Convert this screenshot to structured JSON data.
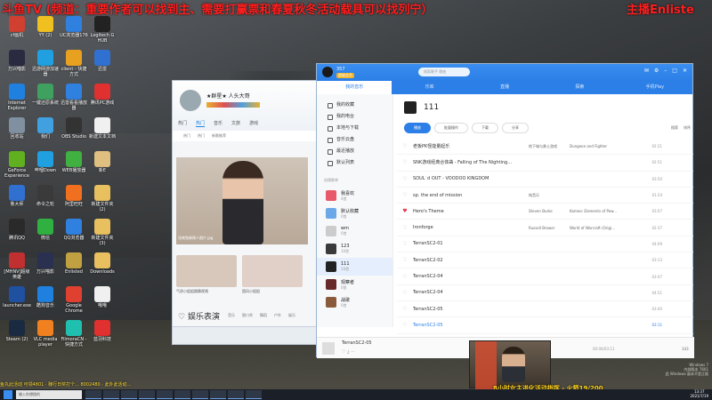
{
  "banner": {
    "left": "斗鱼TV (频道：重要作者可以找到主、需要打赢票和春夏秋冬活动载具可以找列宁）",
    "right": "主播Enliste"
  },
  "desktop_icons": [
    {
      "label": "cf画机",
      "color": "#d04030"
    },
    {
      "label": "YY (2)",
      "color": "#f0c020"
    },
    {
      "label": "UC浏览器176",
      "color": "#3080e0"
    },
    {
      "label": "Logitech G HUB",
      "color": "#222222"
    },
    {
      "label": "万兴喵影",
      "color": "#2a2a40"
    },
    {
      "label": "迅游网游加速器",
      "color": "#20a0e0"
    },
    {
      "label": "client - 快捷方式",
      "color": "#e8a020"
    },
    {
      "label": "迅雷",
      "color": "#3070d0"
    },
    {
      "label": "Internet Explorer",
      "color": "#2080e0"
    },
    {
      "label": "一键还原系统",
      "color": "#40a060"
    },
    {
      "label": "迅雷看看播放器",
      "color": "#3080e0"
    },
    {
      "label": "腾讯PC游戏",
      "color": "#e03030"
    },
    {
      "label": "回收站",
      "color": "#8090a0"
    },
    {
      "label": "我们",
      "color": "#40a0e0"
    },
    {
      "label": "OBS Studio",
      "color": "#333333"
    },
    {
      "label": "新建文本文档",
      "color": "#f0f0f0"
    },
    {
      "label": "GeForce Experience",
      "color": "#60b020"
    },
    {
      "label": "哔哩Down",
      "color": "#20a0e0"
    },
    {
      "label": "WEB播放器",
      "color": "#40b040"
    },
    {
      "label": "新E",
      "color": "#e0c080"
    },
    {
      "label": "鲁大师",
      "color": "#3070d0"
    },
    {
      "label": "命令之轮",
      "color": "#3a3a3a"
    },
    {
      "label": "阿里旺旺",
      "color": "#f07020"
    },
    {
      "label": "新建文件夹 (2)",
      "color": "#e8c060"
    },
    {
      "label": "腾讯QQ",
      "color": "#2a2a2a"
    },
    {
      "label": "微信",
      "color": "#30b040"
    },
    {
      "label": "QQ浏览器",
      "color": "#3080e0"
    },
    {
      "label": "新建文件夹 (3)",
      "color": "#e8c060"
    },
    {
      "label": "[MHNV]超级英雄",
      "color": "#c03030"
    },
    {
      "label": "万兴喵影",
      "color": "#2a3050"
    },
    {
      "label": "Enlisted",
      "color": "#c0a040"
    },
    {
      "label": "Downloads",
      "color": "#e8c060"
    },
    {
      "label": "launcher.exe",
      "color": "#2050a0"
    },
    {
      "label": "酷狗音乐",
      "color": "#2080e0"
    },
    {
      "label": "Google Chrome",
      "color": "#e04030"
    },
    {
      "label": "哦哦",
      "color": "#f0f0f0"
    },
    {
      "label": "Steam (2)",
      "color": "#1a2a40"
    },
    {
      "label": "VLC media player",
      "color": "#f08020"
    },
    {
      "label": "FilmoraCN - 快捷方式",
      "color": "#20c0b0"
    },
    {
      "label": "蓝羽科技",
      "color": "#e03030"
    }
  ],
  "qq_window": {
    "nickname": "★群星★  人头大哥",
    "tabs": [
      "热门",
      "热门",
      "音乐",
      "文旅",
      "游戏"
    ],
    "subtabs": [
      "热门",
      "热门",
      "新歌推荐"
    ],
    "banner_caption": "深夜独奏撩人图片.jpg",
    "thumb_caption_1": "气质小姐姐跳舞视频",
    "thumb_caption_2": "国风小姐姐",
    "section_title": "娱乐表演",
    "section_tabs": [
      "音乐",
      "脱口秀",
      "舞蹈",
      "户外",
      "娱乐"
    ]
  },
  "music": {
    "user": "357",
    "vip": "超级会员",
    "search_placeholder": "搜索歌手 歌曲",
    "nav": [
      "我的音乐",
      "乐库",
      "直播",
      "探索",
      "手机Play"
    ],
    "sidebar": {
      "items": [
        "我的收藏",
        "我的电台",
        "本地与下载",
        "音乐云盘",
        "最近播放",
        "默认列表"
      ],
      "group": "创建歌单",
      "playlists": [
        {
          "name": "我喜欢",
          "count": "4首",
          "color": "#e85a6a"
        },
        {
          "name": "默认收藏",
          "count": "0首",
          "color": "#6aa8e8"
        },
        {
          "name": "wm",
          "count": "0首",
          "color": "#cccccc"
        },
        {
          "name": "123",
          "count": "10首",
          "color": "#3a3a3a"
        },
        {
          "name": "111",
          "count": "14首",
          "color": "#222222"
        },
        {
          "name": "观察者",
          "count": "0首",
          "color": "#6a2a2a"
        },
        {
          "name": "战歌",
          "count": "0首",
          "color": "#8a5a3a"
        }
      ]
    },
    "playlist_title": "111",
    "toolbar": {
      "play": "播放",
      "batch": "批量操作",
      "download": "下载",
      "share": "分享",
      "search": "搜索",
      "sort": "排序"
    },
    "songs": [
      {
        "title": "老板PK怪能量起乐",
        "artist": "地下城与勇士游戏",
        "album": "Dungeon and Fighter",
        "duration": "02:21",
        "liked": false
      },
      {
        "title": "SNK游戏经典合体曲 - Falling of The Nighting...",
        "artist": "",
        "album": "",
        "duration": "02:51",
        "liked": false
      },
      {
        "title": "SOUL`d OUT - VOODOO KINGDOM",
        "artist": "",
        "album": "",
        "duration": "03:50",
        "liked": false
      },
      {
        "title": "sp. the end of mission",
        "artist": "纯音乐",
        "album": "",
        "duration": "01:24",
        "liked": false
      },
      {
        "title": "Hero's Theme",
        "artist": "Steven Burke",
        "album": "Kameo: Elements of Pow...",
        "duration": "03:07",
        "liked": true
      },
      {
        "title": "Ironforge",
        "artist": "Russell Brower",
        "album": "World of Warcraft (Origi...",
        "duration": "02:37",
        "liked": false
      },
      {
        "title": "TerranSC2-01",
        "artist": "",
        "album": "",
        "duration": "04:09",
        "liked": false
      },
      {
        "title": "TerranSC2-02",
        "artist": "",
        "album": "",
        "duration": "03:13",
        "liked": false
      },
      {
        "title": "TerranSC2-04",
        "artist": "",
        "album": "",
        "duration": "03:47",
        "liked": false
      },
      {
        "title": "TerranSC2-04",
        "artist": "",
        "album": "",
        "duration": "04:51",
        "liked": false
      },
      {
        "title": "TerranSC2-05",
        "artist": "",
        "album": "",
        "duration": "03:40",
        "liked": false
      },
      {
        "title": "TerranSC2-05",
        "artist": "",
        "album": "",
        "duration": "03:11",
        "liked": false
      }
    ],
    "now_playing": "TerranSC2-05",
    "time": "00:00/03:11",
    "count": "143"
  },
  "overlay_bottom": "8小时女主进化活动指挥 - 火箭19/200",
  "taskbar": {
    "search": "输入你想搜的",
    "time": "13:37",
    "date": "2021/7/19",
    "ticker": "鱼丸此活动 可领4801 · 赚行日奖打个... 8002480 · 此外此活动..."
  },
  "watermark": {
    "line1": "Windows 7",
    "line2": "内部版本 7601",
    "line3": "此 Windows 副本不是正版"
  }
}
